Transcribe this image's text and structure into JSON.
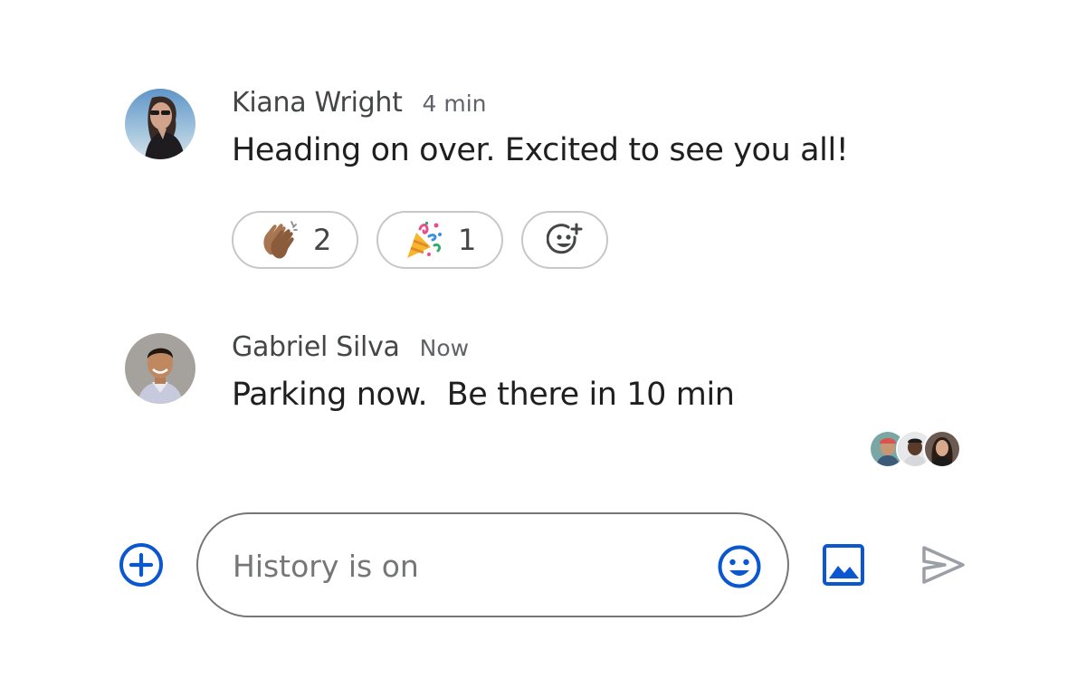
{
  "messages": [
    {
      "sender": "Kiana Wright",
      "time": "4 min",
      "text": "Heading on over. Excited to see you all!",
      "reactions": [
        {
          "emoji": "clapping-hands-medium-skin-tone",
          "count": "2"
        },
        {
          "emoji": "party-popper",
          "count": "1"
        }
      ],
      "add_reaction_icon": "add-reaction-icon"
    },
    {
      "sender": "Gabriel Silva",
      "time": "Now",
      "text": "Parking now.  Be there in 10 min",
      "read_by_count": 3
    }
  ],
  "composer": {
    "placeholder": "History is on",
    "value": "",
    "icons": {
      "add": "add-circle-icon",
      "emoji": "emoji-icon",
      "image": "image-icon",
      "send": "send-icon"
    }
  },
  "colors": {
    "accent": "#0b57d0",
    "send_disabled": "#9aa0a6",
    "chip_border": "#c7c7c7",
    "composer_border": "#747775",
    "secondary_text": "#5f6368"
  }
}
